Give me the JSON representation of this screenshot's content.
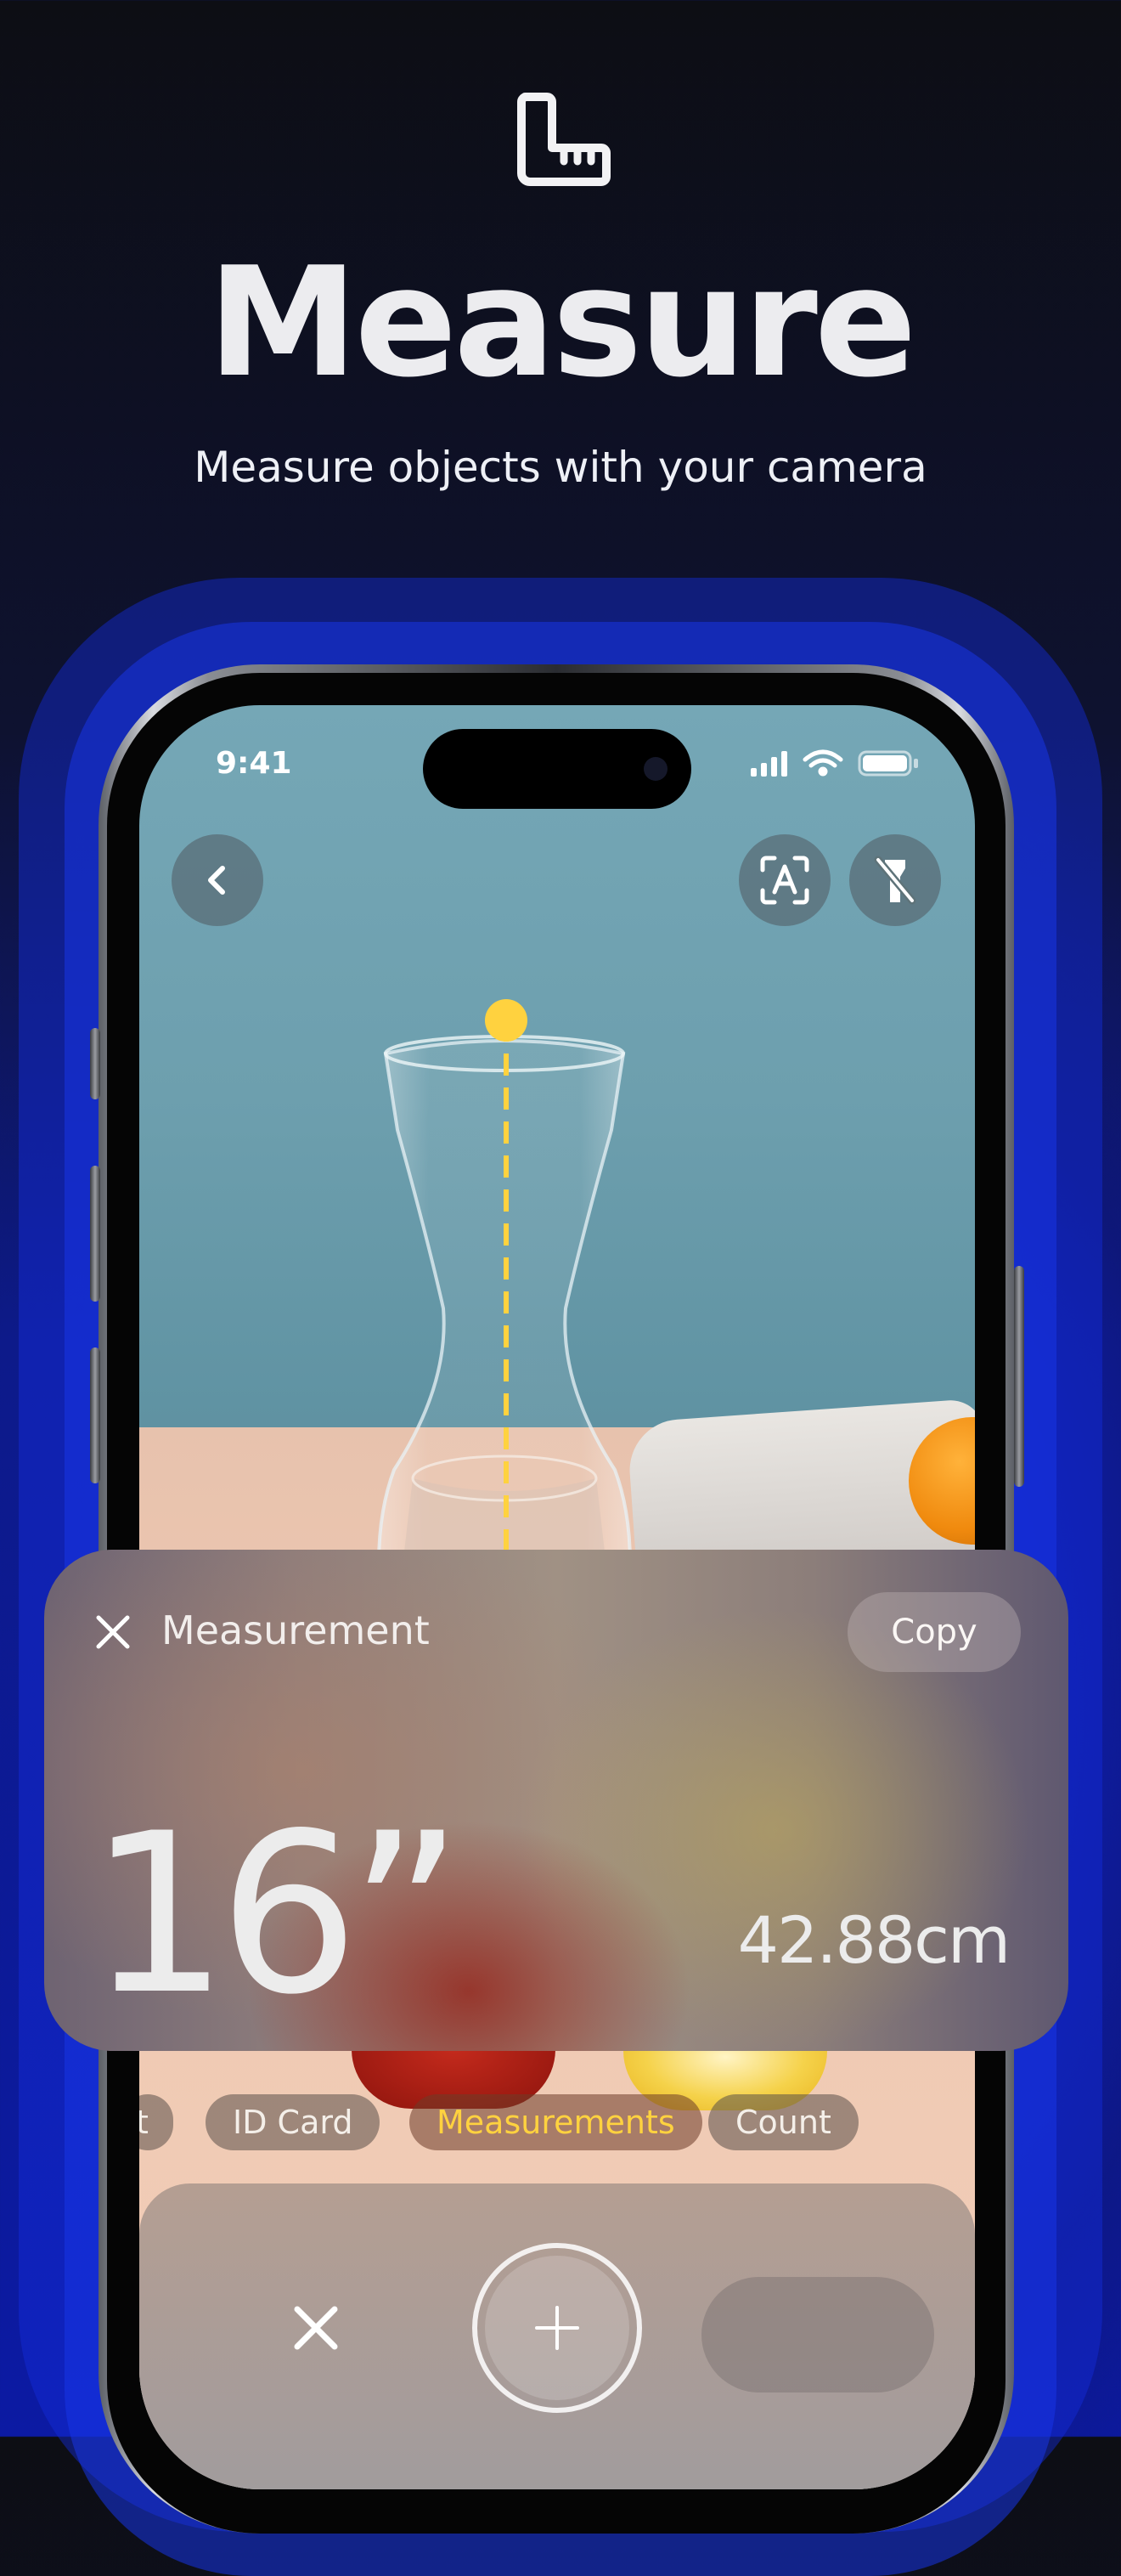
{
  "header": {
    "icon": "ruler-square-icon",
    "title": "Measure",
    "subtitle": "Measure objects with your camera"
  },
  "status_bar": {
    "time": "9:41",
    "icons": [
      "cellular-signal-icon",
      "wifi-icon",
      "battery-icon"
    ]
  },
  "camera_controls": {
    "back_icon": "chevron-left-icon",
    "text_scan_icon": "text-scan-icon",
    "flashlight_icon": "flashlight-off-icon"
  },
  "measurement_card": {
    "close_icon": "close-icon",
    "label": "Measurement",
    "copy_label": "Copy",
    "primary_value": "16”",
    "secondary_value": "42.88cm"
  },
  "modes": {
    "items": [
      {
        "label": "t",
        "active": false
      },
      {
        "label": "ID Card",
        "active": false
      },
      {
        "label": "Measurements",
        "active": true
      },
      {
        "label": "Count",
        "active": false
      }
    ]
  },
  "bottom_bar": {
    "close_icon": "close-icon",
    "add_icon": "plus-icon"
  },
  "colors": {
    "accent": "#ffd23f",
    "background_dark": "#0d0e14",
    "background_blue": "#0c1aa3"
  }
}
